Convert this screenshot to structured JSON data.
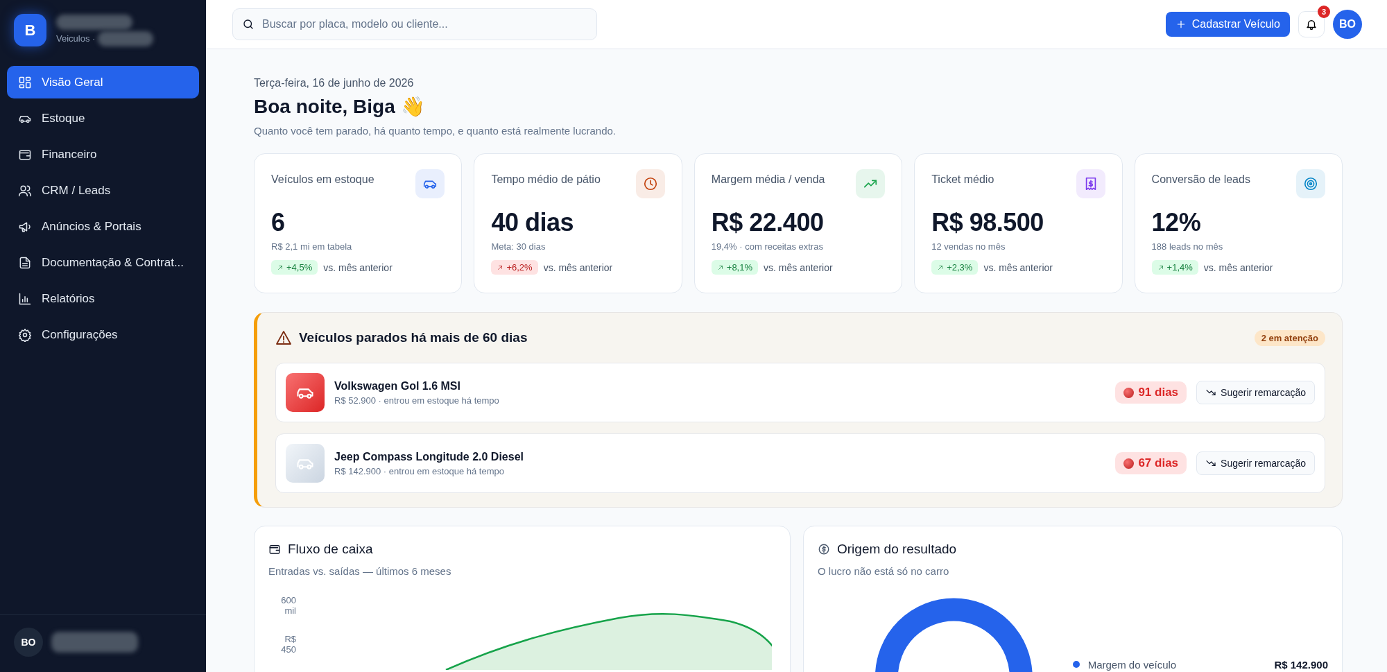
{
  "sidebar": {
    "logo_letter": "B",
    "brand_subtitle": "Veiculos ·",
    "items": [
      {
        "label": "Visão Geral",
        "selected": true
      },
      {
        "label": "Estoque",
        "selected": false
      },
      {
        "label": "Financeiro",
        "selected": false
      },
      {
        "label": "CRM / Leads",
        "selected": false
      },
      {
        "label": "Anúncios & Portais",
        "selected": false
      },
      {
        "label": "Documentação & Contrat...",
        "selected": false
      },
      {
        "label": "Relatórios",
        "selected": false
      },
      {
        "label": "Configurações",
        "selected": false
      }
    ],
    "user": {
      "initials": "BO"
    }
  },
  "topbar": {
    "search": {
      "placeholder": "Buscar por placa, modelo ou cliente..."
    },
    "primary_button": "Cadastrar Veículo",
    "notifications_count": "3",
    "avatar": "BO"
  },
  "header": {
    "date": "Terça-feira, 16 de junho de 2026",
    "greeting": "Boa noite, Biga 👋",
    "subtitle": "Quanto você tem parado, há quanto tempo, e quanto está realmente lucrando."
  },
  "kpis": [
    {
      "title": "Veículos em estoque",
      "color": "#2563eb",
      "value": "6",
      "note": "R$ 2,1 mi em tabela",
      "delta": "+4,5%",
      "kind": "good",
      "compare": "vs. mês anterior"
    },
    {
      "title": "Tempo médio de pátio",
      "color": "#c2410c",
      "value": "40 dias",
      "note": "Meta: 30 dias",
      "delta": "+6,2%",
      "kind": "bad",
      "compare": "vs. mês anterior"
    },
    {
      "title": "Margem média / venda",
      "color": "#16a34a",
      "value": "R$ 22.400",
      "note": "19,4% · com receitas extras",
      "delta": "+8,1%",
      "kind": "good",
      "compare": "vs. mês anterior"
    },
    {
      "title": "Ticket médio",
      "color": "#7c3aed",
      "value": "R$ 98.500",
      "note": "12 vendas no mês",
      "delta": "+2,3%",
      "kind": "good",
      "compare": "vs. mês anterior"
    },
    {
      "title": "Conversão de leads",
      "color": "#0284c7",
      "value": "12%",
      "note": "188 leads no mês",
      "delta": "+1,4%",
      "kind": "good",
      "compare": "vs. mês anterior"
    }
  ],
  "alert": {
    "title": "Veículos parados há mais de 60 dias",
    "badge": "2 em atenção",
    "vehicles": [
      {
        "name": "Volkswagen Gol 1.6 MSI",
        "detail": "R$ 52.900 · entrou em estoque há tempo",
        "kind": "danger",
        "days": "91 dias",
        "action": "Sugerir remarcação"
      },
      {
        "name": "Jeep Compass Longitude 2.0 Diesel",
        "detail": "R$ 142.900 · entrou em estoque há tempo",
        "kind": "muted",
        "days": "67 dias",
        "action": "Sugerir remarcação"
      }
    ]
  },
  "cash_flow": {
    "title": "Fluxo de caixa",
    "subtitle": "Entradas vs. saídas — últimos 6 meses",
    "y_labels": [
      "600 mil",
      "R$ 450"
    ]
  },
  "result_origin": {
    "title": "Origem do resultado",
    "subtitle": "O lucro não está só no carro",
    "legend": [
      {
        "label": "Margem do veículo",
        "value": "R$ 142.900",
        "color": "#2563eb"
      }
    ]
  }
}
